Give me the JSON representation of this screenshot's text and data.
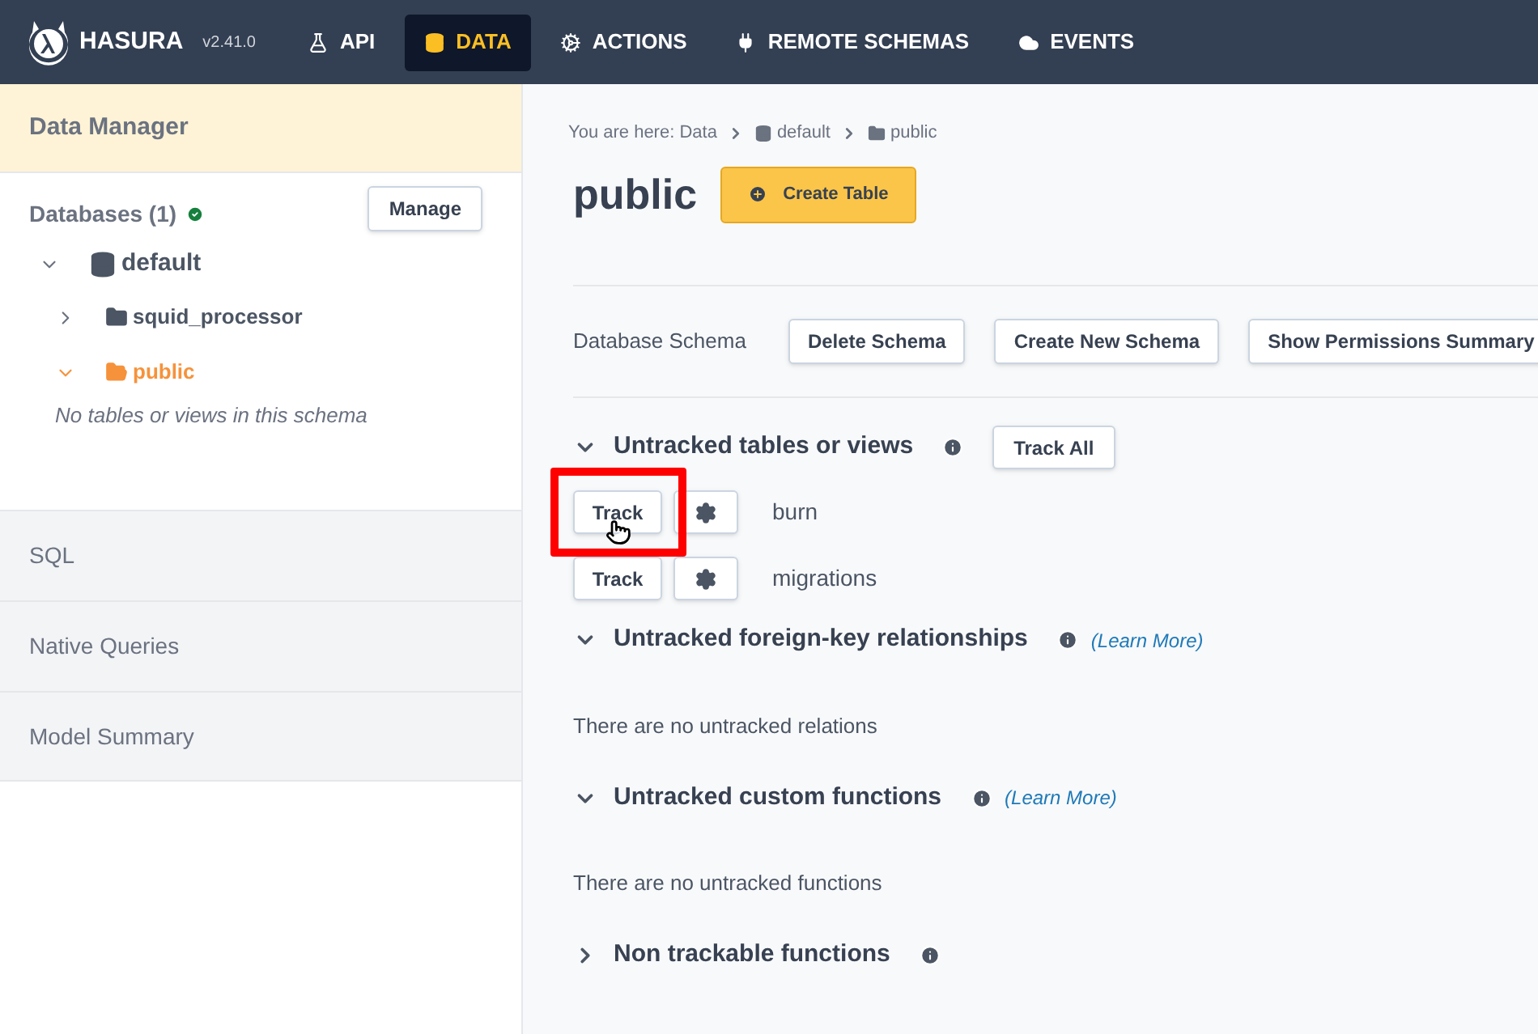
{
  "brand": {
    "name": "HASURA",
    "version": "v2.41.0"
  },
  "nav": [
    {
      "label": "API",
      "selected": false
    },
    {
      "label": "DATA",
      "selected": true
    },
    {
      "label": "ACTIONS",
      "selected": false
    },
    {
      "label": "REMOTE SCHEMAS",
      "selected": false
    },
    {
      "label": "EVENTS",
      "selected": false
    }
  ],
  "sidebar": {
    "title": "Data Manager",
    "databases_label": "Databases (1)",
    "databases_ok": true,
    "manage_button": "Manage",
    "tree": [
      {
        "label": "default",
        "kind": "database",
        "expanded": true,
        "selected": false,
        "children": [
          {
            "label": "squid_processor",
            "kind": "schema",
            "expanded": false,
            "selected": false
          },
          {
            "label": "public",
            "kind": "schema",
            "expanded": true,
            "selected": true,
            "empty_note": "No tables or views in this schema"
          }
        ]
      }
    ],
    "sections": [
      {
        "label": "SQL"
      },
      {
        "label": "Native Queries"
      },
      {
        "label": "Model Summary"
      }
    ]
  },
  "breadcrumb": [
    "You are here: Data",
    "default",
    "public"
  ],
  "page_title": "public",
  "create_button": "Create Table",
  "schema_row": {
    "label": "Database Schema",
    "buttons": [
      "Delete Schema",
      "Create New Schema",
      "Show Permissions Summary"
    ]
  },
  "sections": [
    {
      "title": "Untracked tables or views",
      "expanded": true,
      "track_all": "Track All",
      "items": [
        {
          "track": "Track",
          "name": "burn",
          "highlighted": true
        },
        {
          "track": "Track",
          "name": "migrations",
          "highlighted": false
        }
      ]
    },
    {
      "title": "Untracked foreign-key relationships",
      "expanded": true,
      "learn_more": "(Learn More)",
      "empty": "There are no untracked relations"
    },
    {
      "title": "Untracked custom functions",
      "expanded": true,
      "learn_more": "(Learn More)",
      "empty": "There are no untracked functions"
    },
    {
      "title": "Non trackable functions",
      "expanded": false
    }
  ]
}
